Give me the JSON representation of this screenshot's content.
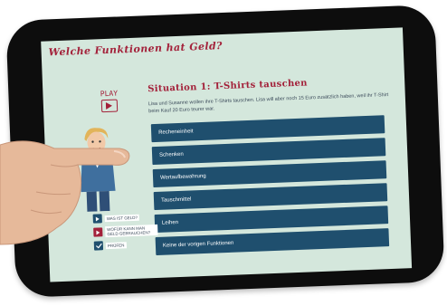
{
  "page_title": "Welche Funktionen hat Geld?",
  "play": {
    "label": "PLAY",
    "icon": "play-icon"
  },
  "situation": {
    "title": "Situation 1: T-Shirts tauschen",
    "text": "Lisa und Susanne wollen ihre T-Shirts tauschen. Lisa will aber noch 15 Euro zusätzlich haben, weil ihr T-Shirt beim Kauf 20 Euro teurer war."
  },
  "options": [
    "Recheneinheit",
    "Schenken",
    "Wertaufbewahrung",
    "Tauschmittel",
    "Leihen",
    "Keine der vorigen Funktionen"
  ],
  "side_menu": [
    {
      "label": "WAS IST GELD?",
      "icon": "play-icon",
      "color": "#1f4f6e"
    },
    {
      "label": "WOFÜR KANN MAN GELD GEBRAUCHEN?",
      "icon": "play-icon",
      "color": "#a3213a"
    },
    {
      "label": "PRÜFEN",
      "icon": "checkmark-icon",
      "color": "#1f4f6e"
    }
  ],
  "colors": {
    "accent": "#a3213a",
    "button": "#1f4f6e",
    "screen_bg": "#d4e7dc"
  }
}
